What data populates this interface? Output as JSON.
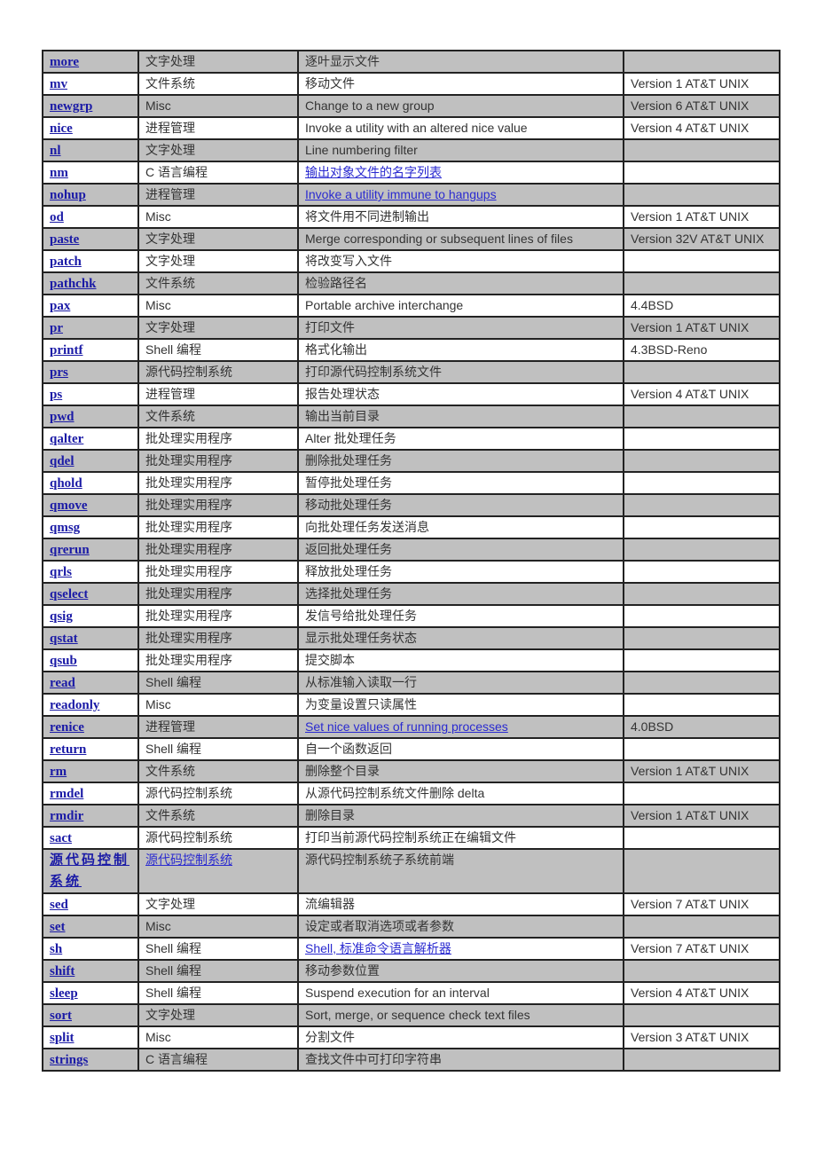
{
  "rows": [
    {
      "name": "more",
      "category": "文字处理",
      "description": "逐叶显示文件",
      "description_link": false,
      "version": ""
    },
    {
      "name": "mv",
      "category": "文件系统",
      "description": "移动文件",
      "description_link": false,
      "version": "Version 1 AT&T UNIX"
    },
    {
      "name": "newgrp",
      "category": "Misc",
      "description": "Change to a new group",
      "description_link": false,
      "version": "Version 6 AT&T UNIX"
    },
    {
      "name": "nice",
      "category": "进程管理",
      "description": "Invoke a utility with an altered nice value",
      "description_link": false,
      "version": "Version 4 AT&T UNIX"
    },
    {
      "name": "nl",
      "category": "文字处理",
      "description": "Line numbering filter",
      "description_link": false,
      "version": ""
    },
    {
      "name": "nm",
      "category": "C 语言编程",
      "description": "输出对象文件的名字列表",
      "description_link": true,
      "version": ""
    },
    {
      "name": "nohup",
      "category": "进程管理",
      "description": "Invoke a utility immune to hangups",
      "description_link": true,
      "version": ""
    },
    {
      "name": "od",
      "category": "Misc",
      "description": "将文件用不同进制输出",
      "description_link": false,
      "version": "Version 1 AT&T UNIX"
    },
    {
      "name": "paste",
      "category": "文字处理",
      "description": "Merge corresponding or subsequent lines of files",
      "description_link": false,
      "version": "Version 32V AT&T UNIX"
    },
    {
      "name": "patch",
      "category": "文字处理",
      "description": "将改变写入文件",
      "description_link": false,
      "version": ""
    },
    {
      "name": "pathchk",
      "category": "文件系统",
      "description": "检验路径名",
      "description_link": false,
      "version": ""
    },
    {
      "name": "pax",
      "category": "Misc",
      "description": "Portable archive interchange",
      "description_link": false,
      "version": "4.4BSD"
    },
    {
      "name": "pr",
      "category": "文字处理",
      "description": "打印文件",
      "description_link": false,
      "version": "Version 1 AT&T UNIX"
    },
    {
      "name": "printf",
      "category": "Shell 编程",
      "description": "格式化输出",
      "description_link": false,
      "version": "4.3BSD-Reno"
    },
    {
      "name": "prs",
      "category": "源代码控制系统",
      "description": "打印源代码控制系统文件",
      "description_link": false,
      "version": ""
    },
    {
      "name": "ps",
      "category": "进程管理",
      "description": "报告处理状态",
      "description_link": false,
      "version": "Version 4 AT&T UNIX"
    },
    {
      "name": "pwd",
      "category": "文件系统",
      "description": "输出当前目录",
      "description_link": false,
      "version": ""
    },
    {
      "name": "qalter",
      "category": "批处理实用程序",
      "description": "Alter  批处理任务",
      "description_link": false,
      "version": ""
    },
    {
      "name": "qdel",
      "category": "批处理实用程序",
      "description": "删除批处理任务",
      "description_link": false,
      "version": ""
    },
    {
      "name": "qhold",
      "category": "批处理实用程序",
      "description": "暂停批处理任务",
      "description_link": false,
      "version": ""
    },
    {
      "name": "qmove",
      "category": "批处理实用程序",
      "description": "移动批处理任务",
      "description_link": false,
      "version": ""
    },
    {
      "name": "qmsg",
      "category": "批处理实用程序",
      "description": "向批处理任务发送消息",
      "description_link": false,
      "version": ""
    },
    {
      "name": "qrerun",
      "category": "批处理实用程序",
      "description": "返回批处理任务",
      "description_link": false,
      "version": ""
    },
    {
      "name": "qrls",
      "category": "批处理实用程序",
      "description": "释放批处理任务",
      "description_link": false,
      "version": ""
    },
    {
      "name": "qselect",
      "category": "批处理实用程序",
      "description": "选择批处理任务",
      "description_link": false,
      "version": ""
    },
    {
      "name": "qsig",
      "category": "批处理实用程序",
      "description": "发信号给批处理任务",
      "description_link": false,
      "version": ""
    },
    {
      "name": "qstat",
      "category": "批处理实用程序",
      "description": "显示批处理任务状态",
      "description_link": false,
      "version": ""
    },
    {
      "name": "qsub",
      "category": "批处理实用程序",
      "description": "提交脚本",
      "description_link": false,
      "version": ""
    },
    {
      "name": "read",
      "category": "Shell 编程",
      "description": "从标准输入读取一行",
      "description_link": false,
      "version": ""
    },
    {
      "name": "readonly",
      "category": "Misc",
      "description": "为变量设置只读属性",
      "description_link": false,
      "version": ""
    },
    {
      "name": "renice",
      "category": "进程管理",
      "description": "Set nice values of running processes",
      "description_link": true,
      "version": "4.0BSD"
    },
    {
      "name": "return",
      "category": "Shell 编程",
      "description": "自一个函数返回",
      "description_link": false,
      "version": ""
    },
    {
      "name": "rm",
      "category": "文件系统",
      "description": "删除整个目录",
      "description_link": false,
      "version": "Version 1 AT&T UNIX"
    },
    {
      "name": "rmdel",
      "category": "源代码控制系统",
      "description": "从源代码控制系统文件删除 delta",
      "description_link": false,
      "version": ""
    },
    {
      "name": "rmdir",
      "category": "文件系统",
      "description": "删除目录",
      "description_link": false,
      "version": "Version 1 AT&T UNIX"
    },
    {
      "name": "sact",
      "category": "源代码控制系统",
      "description": "打印当前源代码控制系统正在编辑文件",
      "description_link": false,
      "version": ""
    },
    {
      "name": "源代码控制系统",
      "category": "源代码控制系统",
      "category_link": true,
      "description": "源代码控制系统子系统前端",
      "description_link": false,
      "version": "",
      "tall": true
    },
    {
      "name": "sed",
      "category": "文字处理",
      "description": "流编辑器",
      "description_link": false,
      "version": "Version 7 AT&T UNIX"
    },
    {
      "name": "set",
      "category": "Misc",
      "description": "设定或者取消选项或者参数",
      "description_link": false,
      "version": ""
    },
    {
      "name": "sh",
      "category": "Shell 编程",
      "description": "Shell,  标准命令语言解析器",
      "description_link": true,
      "version": "Version 7 AT&T UNIX"
    },
    {
      "name": "shift",
      "category": "Shell 编程",
      "description": "移动参数位置",
      "description_link": false,
      "version": ""
    },
    {
      "name": "sleep",
      "category": "Shell 编程",
      "description": "Suspend execution for an interval",
      "description_link": false,
      "version": "Version 4 AT&T UNIX"
    },
    {
      "name": "sort",
      "category": "文字处理",
      "description": "Sort, merge, or sequence check text files",
      "description_link": false,
      "version": ""
    },
    {
      "name": "split",
      "category": "Misc",
      "description": "分割文件",
      "description_link": false,
      "version": "Version 3 AT&T UNIX"
    },
    {
      "name": "strings",
      "category": "C 语言编程",
      "description": "查找文件中可打印字符串",
      "description_link": false,
      "version": ""
    }
  ]
}
